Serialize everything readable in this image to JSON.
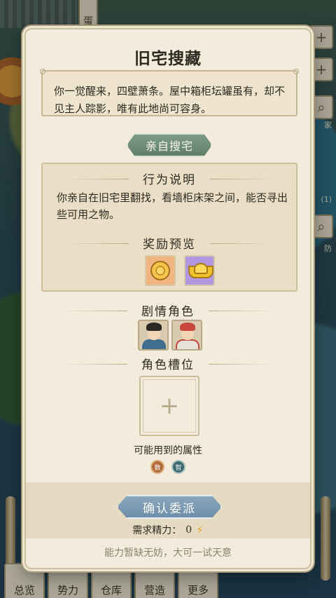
{
  "background": {
    "top_sign": "蛋",
    "side_labels": [
      "家",
      "(1)",
      "防"
    ],
    "bottom_nav": [
      "总览",
      "势力",
      "仓库",
      "营造",
      "更多"
    ]
  },
  "dialog": {
    "title": "旧宅搜藏",
    "intro": "你一觉醒来，四壁萧条。屋中箱柜坛罐虽有，却不见主人踪影，唯有此地尚可容身。",
    "action_tag": "亲自搜宅",
    "behavior_heading": "行为说明",
    "behavior_text": "你亲自在旧宅里翻找，看墙柜床架之间，能否寻出些可用之物。",
    "reward_heading": "奖励预览",
    "rewards": [
      {
        "icon": "coin-icon",
        "bg": "#f1b580"
      },
      {
        "icon": "gold-ingot-icon",
        "bg": "#b196e0"
      }
    ],
    "story_role_heading": "剧情角色",
    "role_slot_heading": "角色槽位",
    "role_slot_plus": "+",
    "attributes_label": "可能用到的属性",
    "attributes": [
      {
        "icon": "attr-icon",
        "text": "数"
      },
      {
        "icon": "attr-icon",
        "text": "智"
      }
    ],
    "confirm_label": "确认委派",
    "energy_label": "需求精力：",
    "energy_value": "0",
    "footer_tip": "能力暂缺无妨，大可一试天意"
  },
  "colors": {
    "action_tag": "#6f8f78",
    "confirm_button": "#7c9bb4",
    "panel_bg": "#f3ecdc",
    "text": "#2e2a21"
  }
}
